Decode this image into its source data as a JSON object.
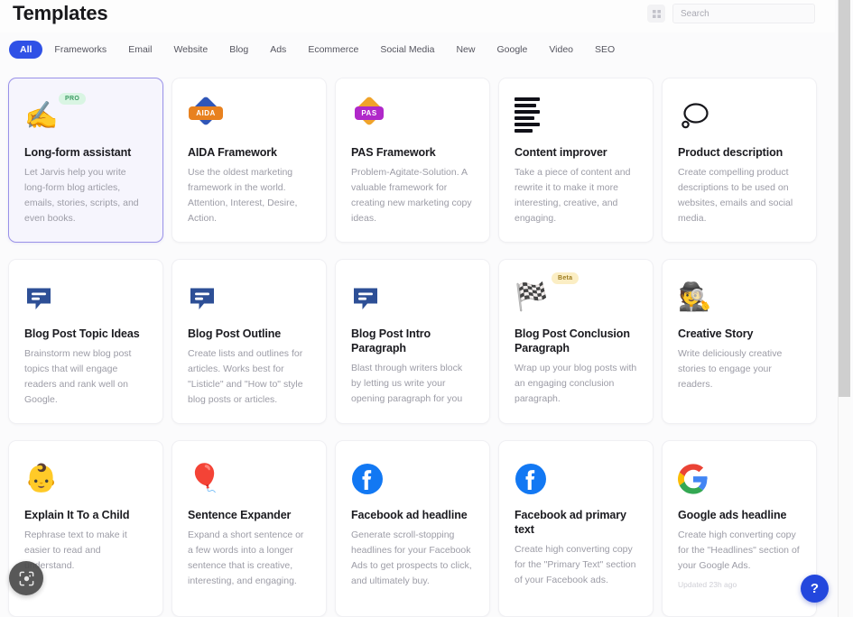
{
  "header": {
    "title": "Templates",
    "grid_icon": "grid-toggle-icon",
    "search": {
      "placeholder": "Search",
      "value": ""
    }
  },
  "filters": {
    "items": [
      {
        "label": "All",
        "active": true
      },
      {
        "label": "Frameworks",
        "active": false
      },
      {
        "label": "Email",
        "active": false
      },
      {
        "label": "Website",
        "active": false
      },
      {
        "label": "Blog",
        "active": false
      },
      {
        "label": "Ads",
        "active": false
      },
      {
        "label": "Ecommerce",
        "active": false
      },
      {
        "label": "Social Media",
        "active": false
      },
      {
        "label": "New",
        "active": false
      },
      {
        "label": "Google",
        "active": false
      },
      {
        "label": "Video",
        "active": false
      },
      {
        "label": "SEO",
        "active": false
      }
    ],
    "active_color": "#2f51e6"
  },
  "cards": [
    {
      "title": "Long-form assistant",
      "desc": "Let Jarvis help you write long-form blog articles, emails, stories, scripts, and even books.",
      "badge": "PRO",
      "badge_type": "pro",
      "icon": "writing-hand-icon",
      "selected": true,
      "meta": ""
    },
    {
      "title": "AIDA Framework",
      "desc": "Use the oldest marketing framework in the world. Attention, Interest, Desire, Action.",
      "badge": "",
      "badge_type": "",
      "icon": "aida-badge-icon",
      "selected": false,
      "meta": ""
    },
    {
      "title": "PAS Framework",
      "desc": "Problem-Agitate-Solution. A valuable framework for creating new marketing copy ideas.",
      "badge": "",
      "badge_type": "",
      "icon": "pas-badge-icon",
      "selected": false,
      "meta": ""
    },
    {
      "title": "Content improver",
      "desc": "Take a piece of content and rewrite it to make it more interesting, creative, and engaging.",
      "badge": "",
      "badge_type": "",
      "icon": "text-lines-icon",
      "selected": false,
      "meta": ""
    },
    {
      "title": "Product description",
      "desc": "Create compelling product descriptions to be used on websites, emails and social media.",
      "badge": "",
      "badge_type": "",
      "icon": "speech-bubble-outline-icon",
      "selected": false,
      "meta": ""
    },
    {
      "title": "Blog Post Topic Ideas",
      "desc": "Brainstorm new blog post topics that will engage readers and rank well on Google.",
      "badge": "",
      "badge_type": "",
      "icon": "blue-chat-icon",
      "selected": false,
      "meta": ""
    },
    {
      "title": "Blog Post Outline",
      "desc": "Create lists and outlines for articles. Works best for \"Listicle\" and \"How to\" style blog posts or articles.",
      "badge": "",
      "badge_type": "",
      "icon": "blue-chat-icon",
      "selected": false,
      "meta": ""
    },
    {
      "title": "Blog Post Intro Paragraph",
      "desc": "Blast through writers block by letting us write your opening paragraph for you",
      "badge": "",
      "badge_type": "",
      "icon": "blue-chat-icon",
      "selected": false,
      "meta": ""
    },
    {
      "title": "Blog Post Conclusion Paragraph",
      "desc": "Wrap up your blog posts with an engaging conclusion paragraph.",
      "badge": "Beta",
      "badge_type": "beta",
      "icon": "checkered-flag-icon",
      "selected": false,
      "meta": ""
    },
    {
      "title": "Creative Story",
      "desc": "Write deliciously creative stories to engage your readers.",
      "badge": "",
      "badge_type": "",
      "icon": "storyteller-person-icon",
      "selected": false,
      "meta": ""
    },
    {
      "title": "Explain It To a Child",
      "desc": "Rephrase text to make it easier to read and understand.",
      "badge": "",
      "badge_type": "",
      "icon": "baby-face-icon",
      "selected": false,
      "meta": ""
    },
    {
      "title": "Sentence Expander",
      "desc": "Expand a short sentence or a few words into a longer sentence that is creative, interesting, and engaging.",
      "badge": "",
      "badge_type": "",
      "icon": "balloon-icon",
      "selected": false,
      "meta": ""
    },
    {
      "title": "Facebook ad headline",
      "desc": "Generate scroll-stopping headlines for your Facebook Ads to get prospects to click, and ultimately buy.",
      "badge": "",
      "badge_type": "",
      "icon": "facebook-icon",
      "selected": false,
      "meta": ""
    },
    {
      "title": "Facebook ad primary text",
      "desc": "Create high converting copy for the \"Primary Text\" section of your Facebook ads.",
      "badge": "",
      "badge_type": "",
      "icon": "facebook-icon",
      "selected": false,
      "meta": ""
    },
    {
      "title": "Google ads headline",
      "desc": "Create high converting copy for the \"Headlines\" section of your Google Ads.",
      "badge": "",
      "badge_type": "",
      "icon": "google-icon",
      "selected": false,
      "meta": "Updated 23h ago"
    }
  ],
  "floating": {
    "lens_label": "google-lens-button",
    "help_label": "?"
  }
}
